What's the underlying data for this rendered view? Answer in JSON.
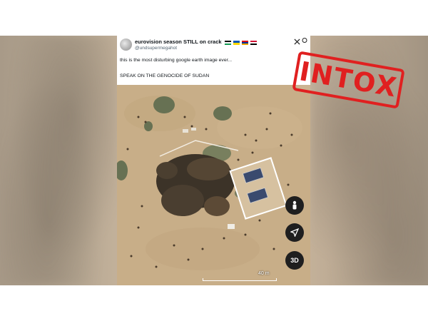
{
  "tweet": {
    "display_name": "eurovision season STILL on crack",
    "handle": "@undsupermegahot",
    "line1": "this is the most disturbing google earth image ever...",
    "line2": "SPEAK ON THE GENOCIDE OF SUDAN",
    "logo_icon": "x-logo-icon",
    "more_icon": "more-options-icon",
    "flag_colors": [
      "#149954",
      "#0057b7",
      "#cc0000",
      "#d21034"
    ]
  },
  "map": {
    "scale_label": "40 m",
    "buttons": [
      {
        "name": "pegman",
        "label": ""
      },
      {
        "name": "navigation",
        "label": ""
      },
      {
        "name": "3d",
        "label": "3D"
      }
    ],
    "ground_color": "#c7ad86"
  },
  "stamp": {
    "text": "INTOX",
    "color": "#e02020"
  }
}
